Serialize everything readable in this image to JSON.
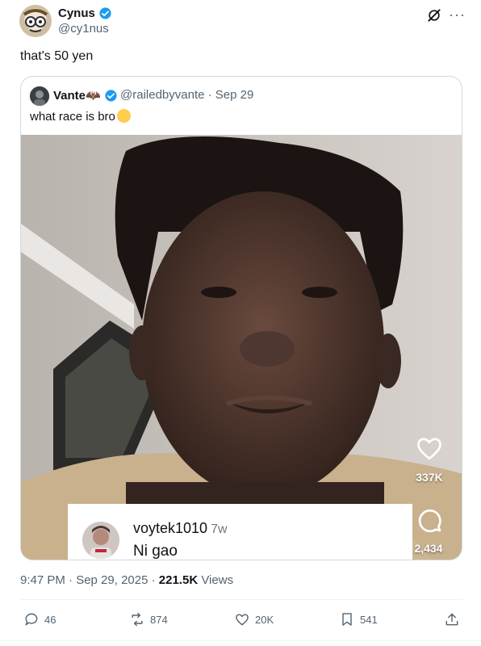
{
  "author": {
    "name": "Cynus",
    "handle": "@cy1nus",
    "verified_color": "#1d9bf0"
  },
  "tweet": {
    "text": "that's 50 yen"
  },
  "quote": {
    "name": "Vante🦇",
    "handle": "@railedbyvante · Sep 29",
    "text": "what race is bro"
  },
  "video_overlay": {
    "likes": "337K",
    "comments": "2,434",
    "comment_user": "voytek1010",
    "comment_time": "7w",
    "comment_text": "Ni gao"
  },
  "meta": {
    "time": "9:47 PM · Sep 29, 2025 · ",
    "views": "221.5K",
    "views_label": " Views"
  },
  "actions": {
    "replies": "46",
    "reposts": "874",
    "likes": "20K",
    "bookmarks": "541"
  },
  "icons": [
    "verified-icon",
    "grok-icon",
    "more-icon",
    "heart-icon",
    "comment-icon",
    "share-icon",
    "reply-icon",
    "repost-icon",
    "like-icon",
    "bookmark-icon",
    "upload-icon"
  ]
}
